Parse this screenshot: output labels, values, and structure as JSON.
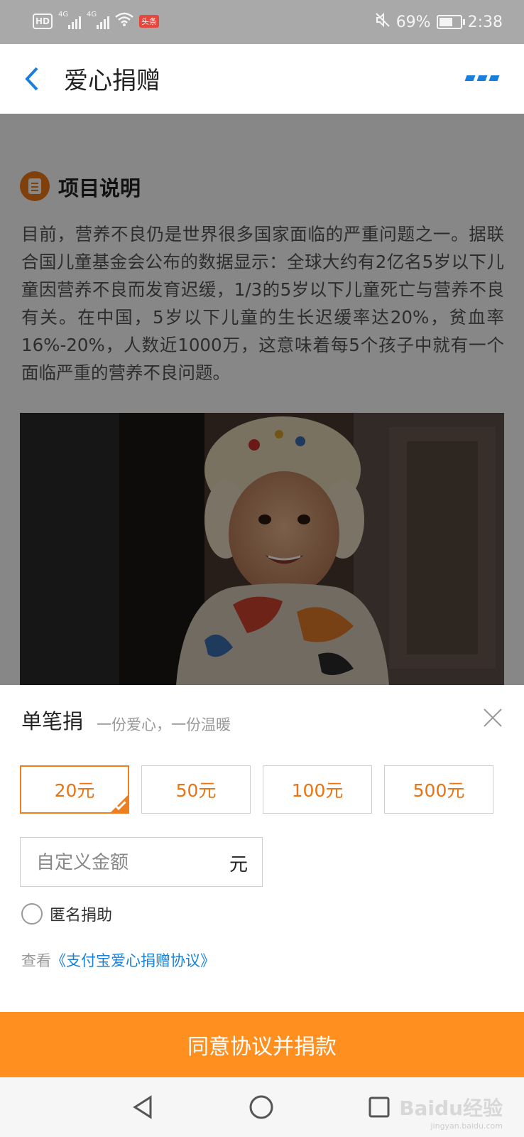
{
  "status_bar": {
    "hd": "HD",
    "net1": "4G",
    "net2": "4G",
    "app_badge": "头条",
    "battery_percent": "69%",
    "battery_level": 0.69,
    "time": "2:38",
    "icons": [
      "signal-icon",
      "wifi-icon",
      "mute-icon",
      "battery-icon"
    ]
  },
  "header": {
    "title": "爱心捐赠",
    "back_icon": "back-arrow-icon",
    "more_icon": "more-icon"
  },
  "project": {
    "section_title": "项目说明",
    "description": "目前，营养不良仍是世界很多国家面临的严重问题之一。据联合国儿童基金会公布的数据显示：全球大约有2亿名5岁以下儿童因营养不良而发育迟缓，1/3的5岁以下儿童死亡与营养不良有关。在中国，5岁以下儿童的生长迟缓率达20%，贫血率16%-20%，人数近1000万，这意味着每5个孩子中就有一个面临严重的营养不良问题。"
  },
  "sheet": {
    "title": "单笔捐",
    "subtitle": "一份爱心，一份温暖",
    "amounts": [
      "20元",
      "50元",
      "100元",
      "500元"
    ],
    "selected_index": 0,
    "custom_placeholder": "自定义金额",
    "custom_unit": "元",
    "anonymous_label": "匿名捐助",
    "agreement_prefix": "查看",
    "agreement_link": "《支付宝爱心捐赠协议》"
  },
  "donate_button": "同意协议并捐款",
  "colors": {
    "accent": "#ff8f1f",
    "amount_text": "#ec7311",
    "link": "#1a82d6",
    "header_more": "#1a7fdc"
  },
  "watermark": {
    "text": "Baidu经验",
    "sub": "jingyan.baidu.com"
  }
}
